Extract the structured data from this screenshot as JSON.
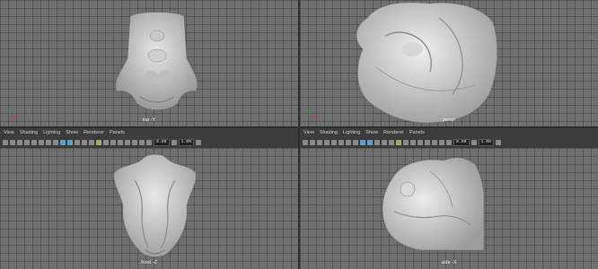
{
  "viewports": {
    "top": {
      "camera": "top -Y"
    },
    "persp": {
      "camera": "persp"
    },
    "front": {
      "camera": "front -Z"
    },
    "side": {
      "camera": "side -X"
    }
  },
  "panel_menu": [
    "View",
    "Shading",
    "Lighting",
    "Show",
    "Renderer",
    "Panels"
  ],
  "toolbar": {
    "field_a": "0.00",
    "field_b": "1.00"
  },
  "colors": {
    "viewport_bg": "#6f6f6f",
    "toolbar_bg": "#3c3c3c",
    "accent": "#5aa0c8"
  }
}
